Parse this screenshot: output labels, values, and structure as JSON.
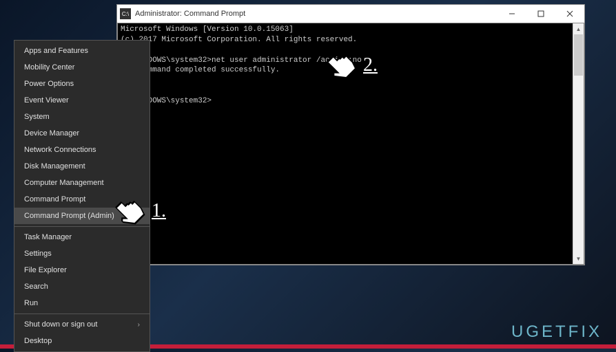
{
  "menu": {
    "items": [
      {
        "label": "Apps and Features"
      },
      {
        "label": "Mobility Center"
      },
      {
        "label": "Power Options"
      },
      {
        "label": "Event Viewer"
      },
      {
        "label": "System"
      },
      {
        "label": "Device Manager"
      },
      {
        "label": "Network Connections"
      },
      {
        "label": "Disk Management"
      },
      {
        "label": "Computer Management"
      },
      {
        "label": "Command Prompt"
      },
      {
        "label": "Command Prompt (Admin)",
        "highlighted": true
      }
    ],
    "group2": [
      {
        "label": "Task Manager"
      },
      {
        "label": "Settings"
      },
      {
        "label": "File Explorer"
      },
      {
        "label": "Search"
      },
      {
        "label": "Run"
      }
    ],
    "group3": [
      {
        "label": "Shut down or sign out",
        "submenu": true
      },
      {
        "label": "Desktop"
      }
    ]
  },
  "cmd": {
    "title": "Administrator: Command Prompt",
    "line1": "Microsoft Windows [Version 10.0.15063]",
    "line2": "(c) 2017 Microsoft Corporation. All rights reserved.",
    "line3": "C:\\WINDOWS\\system32>net user administrator /active:no",
    "line4": "The command completed successfully.",
    "line5": "",
    "line6": "C:\\WINDOWS\\system32>"
  },
  "annotations": {
    "num1": "1.",
    "num2": "2."
  },
  "watermark": "UGETFIX"
}
